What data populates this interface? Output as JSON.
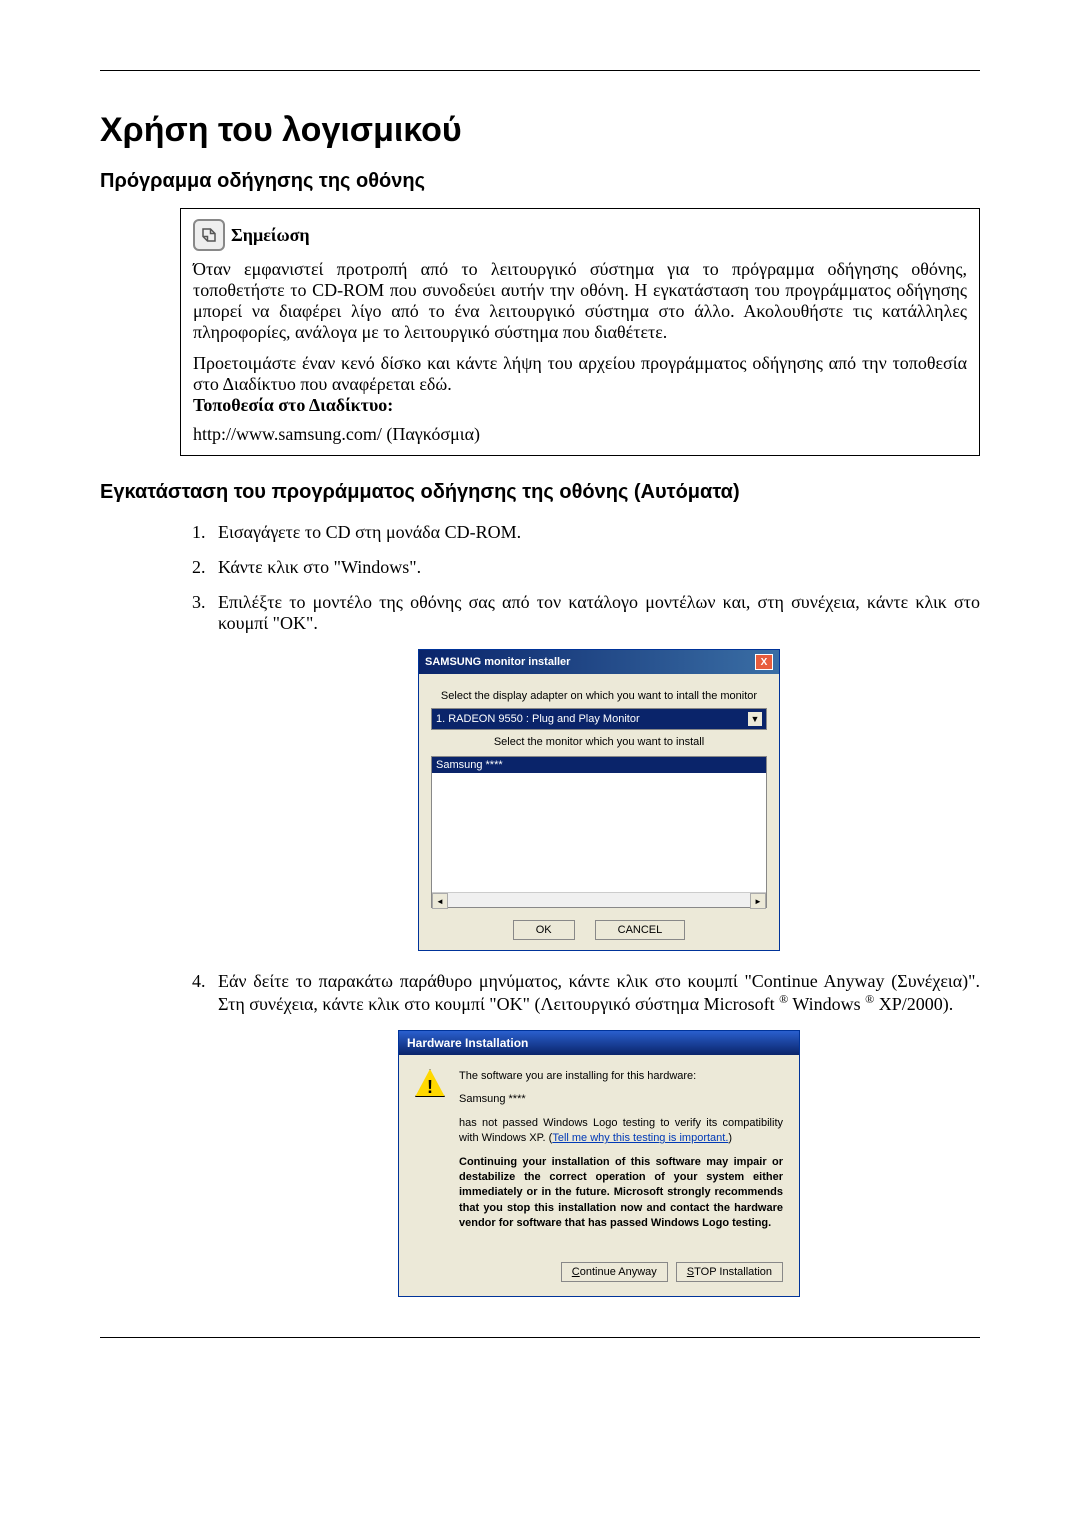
{
  "page": {
    "title": "Χρήση του λογισμικού",
    "section1_title": "Πρόγραμμα οδήγησης της οθόνης",
    "section2_title": "Εγκατάσταση του προγράμματος οδήγησης της οθόνης (Αυτόματα)"
  },
  "note": {
    "label": "Σημείωση",
    "p1": "Όταν εμφανιστεί προτροπή από το λειτουργικό σύστημα για το πρόγραμμα οδήγησης οθόνης, τοποθετήστε το CD-ROM που συνοδεύει αυτήν την οθόνη. Η εγκατάσταση του προγράμματος οδήγησης μπορεί να διαφέρει λίγο από το ένα λειτουργικό σύστημα στο άλλο. Ακολουθήστε τις κατάλληλες πληροφορίες, ανάλογα με το λειτουργικό σύστημα που διαθέτετε.",
    "p2": "Προετοιμάστε έναν κενό δίσκο και κάντε λήψη του αρχείου προγράμματος οδήγησης από την τοποθεσία στο Διαδίκτυο που αναφέρεται εδώ.",
    "website_label": "Τοποθεσία στο Διαδίκτυο:",
    "url": "http://www.samsung.com/ (Παγκόσμια)"
  },
  "steps": {
    "s1": "Εισαγάγετε το CD στη μονάδα CD-ROM.",
    "s2": "Κάντε κλικ στο \"Windows\".",
    "s3": "Επιλέξτε το μοντέλο της οθόνης σας από τον κατάλογο μοντέλων και, στη συνέχεια, κάντε κλικ στο κουμπί \"OK\".",
    "s4_a": "Εάν δείτε το παρακάτω παράθυρο μηνύματος, κάντε κλικ στο κουμπί \"Continue Anyway (Συνέχεια)\". Στη συνέχεια, κάντε κλικ στο κουμπί \"OK\" (Λειτουργικό σύστημα Microsoft ",
    "s4_b": "Windows ",
    "s4_c": " XP/2000)."
  },
  "dialog1": {
    "title": "SAMSUNG monitor installer",
    "close": "X",
    "label1": "Select the display adapter on which you want to intall the monitor",
    "select_value": "1. RADEON 9550 : Plug and Play Monitor",
    "label2": "Select the monitor which you want to install",
    "list_item": "Samsung ****",
    "btn_ok": "OK",
    "btn_cancel": "CANCEL"
  },
  "dialog2": {
    "title": "Hardware Installation",
    "p1": "The software you are installing for this hardware:",
    "p2": "Samsung ****",
    "p3a": "has not passed Windows Logo testing to verify its compatibility with Windows XP. (",
    "p3_link": "Tell me why this testing is important.",
    "p3b": ")",
    "p4": "Continuing your installation of this software may impair or destabilize the correct operation of your system either immediately or in the future. Microsoft strongly recommends that you stop this installation now and contact the hardware vendor for software that has passed Windows Logo testing.",
    "btn_continue_pre": "C",
    "btn_continue_rest": "ontinue Anyway",
    "btn_stop_pre": "S",
    "btn_stop_rest": "TOP Installation"
  }
}
